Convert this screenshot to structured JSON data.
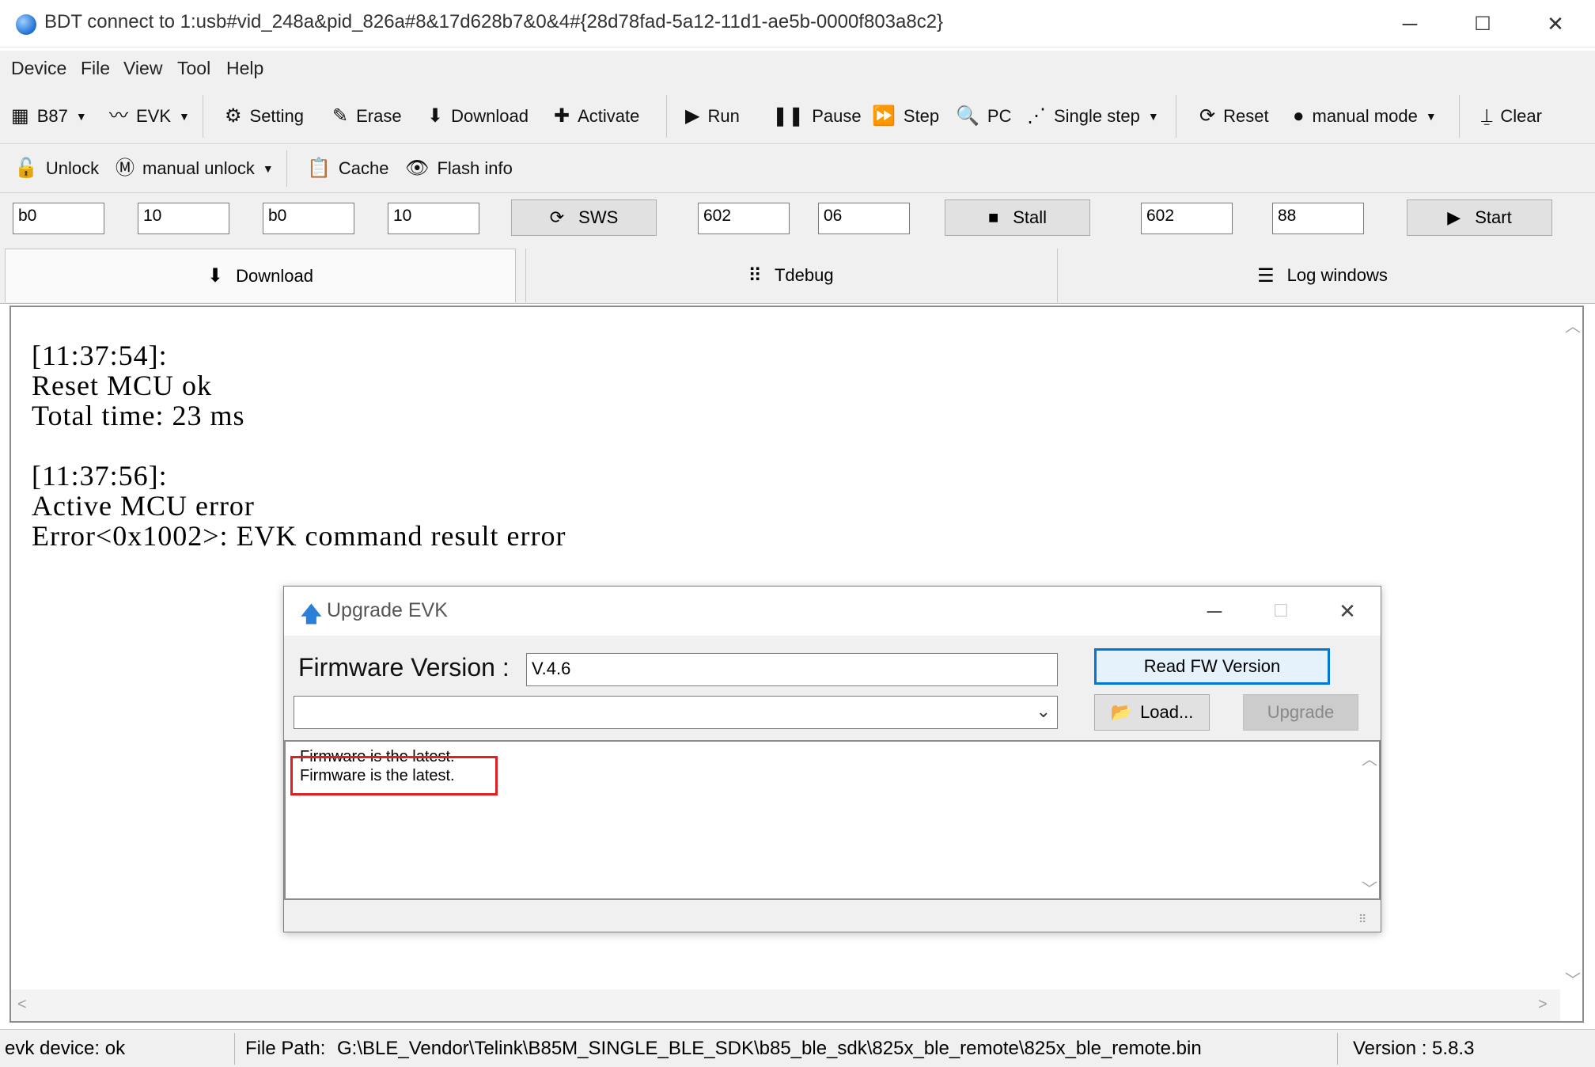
{
  "window": {
    "title": "BDT connect to 1:usb#vid_248a&pid_826a#8&17d628b7&0&4#{28d78fad-5a12-11d1-ae5b-0000f803a8c2}",
    "minimize": "─",
    "maximize": "☐",
    "close": "✕"
  },
  "menu": [
    "Device",
    "File",
    "View",
    "Tool",
    "Help"
  ],
  "toolbar1": {
    "chip": "B87",
    "evk": "EVK",
    "setting": "Setting",
    "erase": "Erase",
    "download": "Download",
    "activate": "Activate",
    "run": "Run",
    "pause": "Pause",
    "step": "Step",
    "pc": "PC",
    "single_step": "Single step",
    "reset": "Reset",
    "manual_mode": "manual mode",
    "clear": "Clear"
  },
  "toolbar2": {
    "unlock": "Unlock",
    "manual_unlock": "manual unlock",
    "cache": "Cache",
    "flash_info": "Flash info"
  },
  "inputs": {
    "f1": "b0",
    "f2": "10",
    "f3": "b0",
    "f4": "10",
    "sws": "SWS",
    "f5": "602",
    "f6": "06",
    "stall": "Stall",
    "f7": "602",
    "f8": "88",
    "start": "Start"
  },
  "tabs": {
    "download": "Download",
    "tdebug": "Tdebug",
    "log_windows": "Log windows"
  },
  "log": {
    "text": "[11:37:54]:\nReset MCU ok\nTotal time: 23 ms\n\n[11:37:56]:\nActive MCU error\nError<0x1002>: EVK command result error"
  },
  "dialog": {
    "title": "Upgrade EVK",
    "fw_label": "Firmware Version :",
    "fw_version": "V.4.6",
    "read_fw_button": "Read FW Version",
    "load_button": "Load...",
    "upgrade_button": "Upgrade",
    "log_lines": [
      "Firmware is the latest.",
      "Firmware is the latest."
    ],
    "highlight_color": "#e02020"
  },
  "status": {
    "device": "evk device: ok",
    "file_path_label": "File Path:",
    "file_path": "G:\\BLE_Vendor\\Telink\\B85M_SINGLE_BLE_SDK\\b85_ble_sdk\\825x_ble_remote\\825x_ble_remote.bin",
    "version": "Version : 5.8.3"
  }
}
